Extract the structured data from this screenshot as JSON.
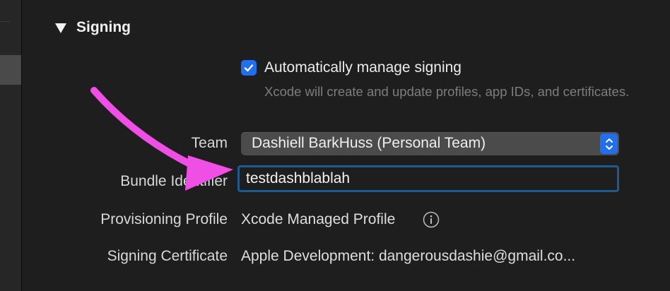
{
  "section": {
    "title": "Signing"
  },
  "auto_signing": {
    "label": "Automatically manage signing",
    "checked": true,
    "help_text": "Xcode will create and update profiles, app IDs, and certificates."
  },
  "fields": {
    "team": {
      "label": "Team",
      "value": "Dashiell BarkHuss (Personal Team)"
    },
    "bundle_identifier": {
      "label": "Bundle Identifier",
      "value": "testdashblablah"
    },
    "provisioning_profile": {
      "label": "Provisioning Profile",
      "value": "Xcode Managed Profile"
    },
    "signing_certificate": {
      "label": "Signing Certificate",
      "value": "Apple Development: dangerousdashie@gmail.co..."
    }
  },
  "colors": {
    "background": "#1e1e1e",
    "accent": "#1f6ff0",
    "focus_ring": "#1a5c8f",
    "annotation_arrow": "#f04fe6"
  },
  "icons": {
    "disclosure": "disclosure-triangle-down-icon",
    "checkbox": "checkmark-icon",
    "popup": "chevron-up-down-icon",
    "info": "info-circle-icon"
  }
}
